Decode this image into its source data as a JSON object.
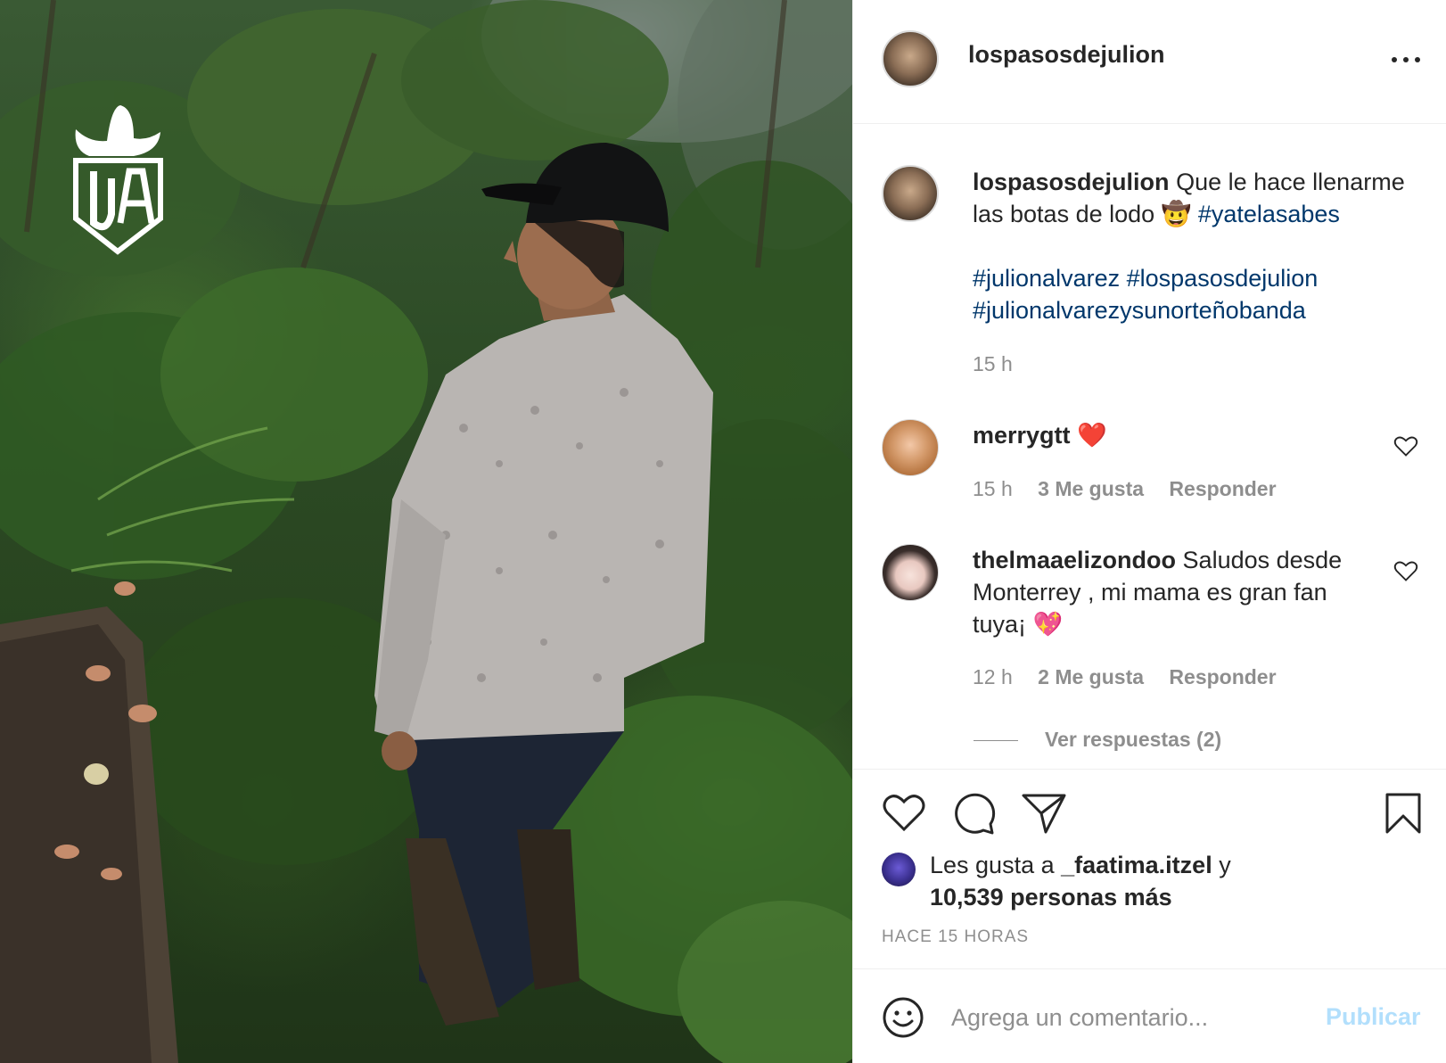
{
  "post": {
    "author": "lospasosdejulion",
    "watermark": "JA",
    "caption": {
      "text": "Que le hace llenarme las botas de lodo",
      "emoji": "🤠",
      "hashtag_inline": "#yatelasabes",
      "hashtags": [
        "#julionalvarez",
        "#lospasosdejulion",
        "#julionalvarezysunorteñobanda"
      ],
      "time": "15 h"
    }
  },
  "comments": [
    {
      "username": "merrygtt",
      "text": "",
      "emoji": "❤️",
      "time": "15 h",
      "likes": "3 Me gusta",
      "reply": "Responder"
    },
    {
      "username": "thelmaaelizondoo",
      "text_line1": "Saludos desde",
      "text_line2": "Monterrey , mi mama es gran fan",
      "text_line3": "tuya¡",
      "emoji": "💖",
      "time": "12 h",
      "likes": "2 Me gusta",
      "reply": "Responder",
      "view_replies": "Ver respuestas (2)"
    }
  ],
  "likes": {
    "prefix": "Les gusta a",
    "user": "_faatima.itzel",
    "conj": "y",
    "others": "10,539 personas más"
  },
  "timestamp": "HACE 15 HORAS",
  "comment_box": {
    "placeholder": "Agrega un comentario...",
    "publish": "Publicar"
  }
}
